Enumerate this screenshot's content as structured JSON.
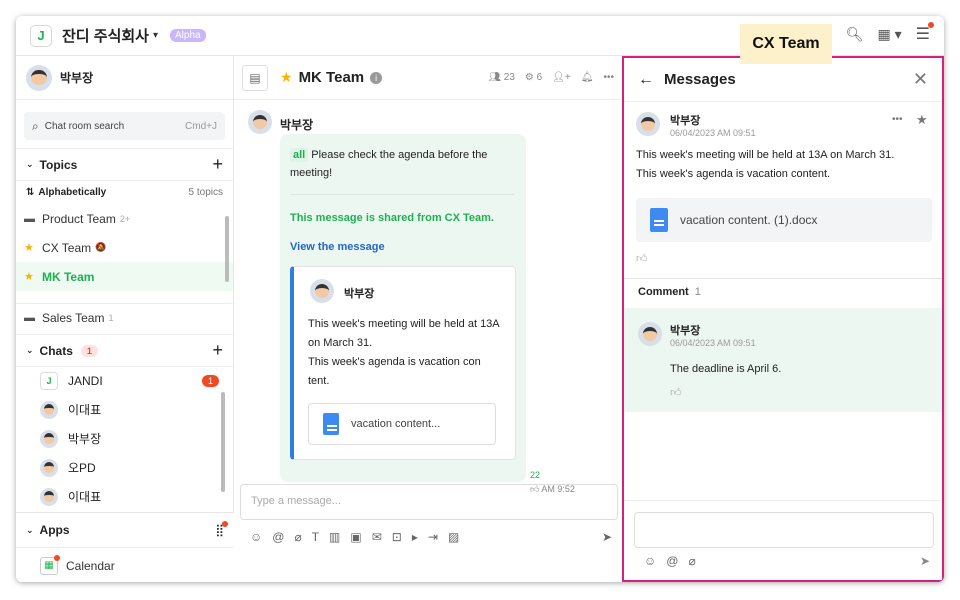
{
  "company": {
    "name": "잔디 주식회사",
    "badge": "Alpha",
    "logo": "J"
  },
  "user": {
    "name": "박부장"
  },
  "search": {
    "placeholder": "Chat room search",
    "shortcut": "Cmd+J"
  },
  "topics": {
    "header": "Topics",
    "sort": "Alphabetically",
    "count": "5 topics",
    "items": [
      {
        "name": "Product Team",
        "meta": "2+",
        "icon": "folder-icon"
      },
      {
        "name": "CX Team",
        "meta": "🔕",
        "icon": "star-icon"
      },
      {
        "name": "MK Team",
        "meta": "",
        "icon": "star-icon"
      },
      {
        "name": "Sales Team",
        "meta": "1",
        "icon": "folder-icon"
      }
    ]
  },
  "chats": {
    "header": "Chats",
    "count": "1",
    "items": [
      {
        "name": "JANDI",
        "badge": "1"
      },
      {
        "name": "이대표",
        "badge": ""
      },
      {
        "name": "박부장",
        "badge": ""
      },
      {
        "name": "오PD",
        "badge": ""
      },
      {
        "name": "이대표",
        "badge": ""
      }
    ]
  },
  "apps": {
    "header": "Apps",
    "calendar": "Calendar"
  },
  "channel": {
    "title": "MK Team",
    "members": "23",
    "connections": "6"
  },
  "message": {
    "author": "박부장",
    "mention": "all",
    "text": "Please check the agenda before the meeting!",
    "shared_prefix": "This message is shared from ",
    "shared_team": "CX Team.",
    "view_link": "View the message",
    "quote_author": "박부장",
    "quote_text_1": "This week's meeting will be held at 13A on March 31.",
    "quote_text_2": "This week's agenda is vacation con tent.",
    "attachment": "vacation content...",
    "unread": "22",
    "time": "AM 9:52"
  },
  "composer": {
    "placeholder": "Type a message..."
  },
  "panel": {
    "title": "Messages",
    "tag": "CX Team",
    "author": "박부장",
    "date": "06/04/2023 AM 09:51",
    "text_1": "This week's meeting will be held at 13A on March 31.",
    "text_2": "This week's agenda is vacation content.",
    "file": "vacation content. (1).docx",
    "comment_label": "Comment",
    "comment_count": "1",
    "comment": {
      "author": "박부장",
      "date": "06/04/2023 AM 09:51",
      "text": "The deadline is April 6."
    }
  },
  "colors": {
    "accent": "#1fb14f",
    "highlight": "#d6207f",
    "link": "#2266c6"
  }
}
